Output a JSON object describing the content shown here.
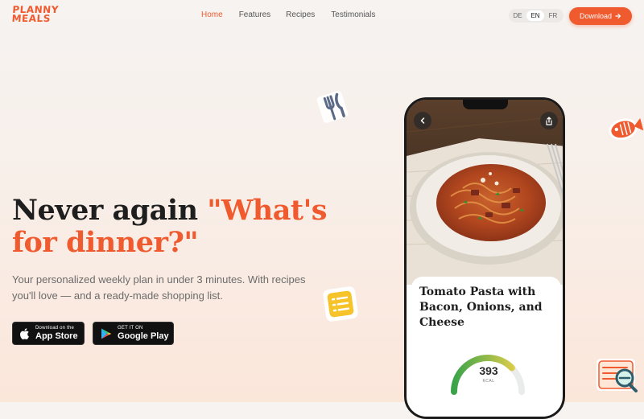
{
  "brand": {
    "logo_line1": "PLANNY",
    "logo_line2": "MEALS"
  },
  "nav": {
    "links": [
      {
        "label": "Home",
        "active": true
      },
      {
        "label": "Features",
        "active": false
      },
      {
        "label": "Recipes",
        "active": false
      },
      {
        "label": "Testimonials",
        "active": false
      }
    ],
    "languages": [
      {
        "label": "DE",
        "active": false
      },
      {
        "label": "EN",
        "active": true
      },
      {
        "label": "FR",
        "active": false
      }
    ],
    "download_label": "Download"
  },
  "hero": {
    "headline_plain": "Never again ",
    "headline_accent_1": "\"What's",
    "headline_accent_2": "for dinner?\"",
    "subtitle": "Your personalized weekly plan in under 3 minutes. With recipes you'll love — and a ready-made shopping list."
  },
  "stores": {
    "apple": {
      "small": "Download on the",
      "big": "App Store"
    },
    "google": {
      "small": "GET IT ON",
      "big": "Google Play"
    }
  },
  "phone": {
    "recipe_title": "Tomato Pasta with Bacon, Onions, and Cheese",
    "calories_value": "393",
    "calories_unit": "KCAL",
    "calories_fraction": 0.75
  },
  "colors": {
    "accent": "#ef5a2f",
    "dark": "#1e1e1e",
    "gauge_start": "#3aa34a",
    "gauge_end": "#f0d24a"
  }
}
